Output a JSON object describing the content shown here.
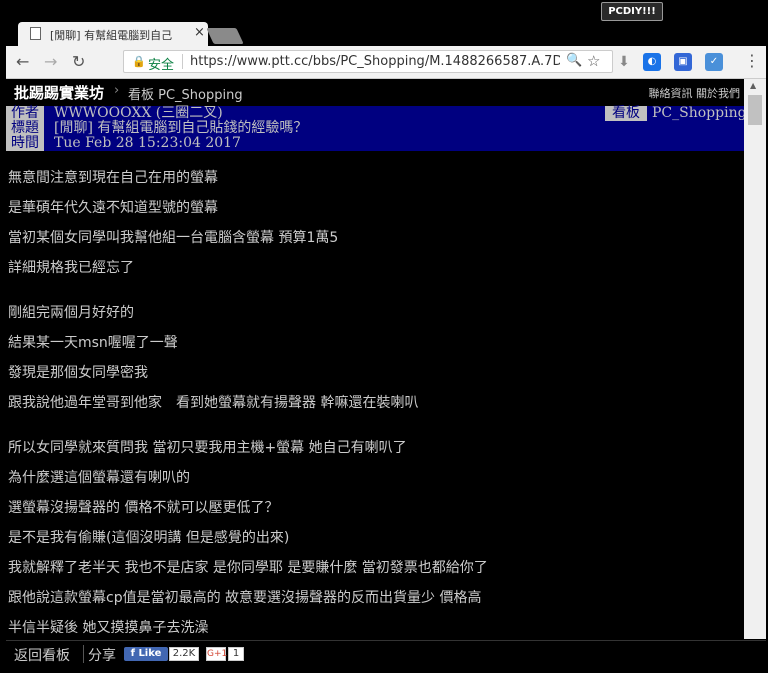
{
  "watermark": "PCDIY!!!",
  "tab": {
    "title": "[閒聊] 有幫組電腦到自己",
    "close": "×"
  },
  "toolbar": {
    "back": "←",
    "forward": "→",
    "reload": "↻",
    "secure_label": "安全",
    "url": "https://www.ptt.cc/bbs/PC_Shopping/M.1488266587.A.7D3",
    "zoom": "🔍",
    "star": "☆",
    "menu": "⋮"
  },
  "header": {
    "brand": "批踢踢實業坊",
    "arrow": "›",
    "board_label": "看板 PC_Shopping",
    "links": "聯絡資訊 關於我們"
  },
  "meta": {
    "author_key": "作者",
    "author": "WWWOOOXX (三圈二叉)",
    "board_key": "看板",
    "board": "PC_Shopping",
    "title_key": "標題",
    "title": "[閒聊] 有幫組電腦到自己貼錢的經驗嗎？",
    "time_key": "時間",
    "time": "Tue Feb 28 15:23:04 2017"
  },
  "content": {
    "lines_1": [
      "無意間注意到現在自己在用的螢幕",
      "是華碩年代久遠不知道型號的螢幕",
      "當初某個女同學叫我幫他組一台電腦含螢幕 預算1萬5",
      "詳細規格我已經忘了"
    ],
    "lines_2": [
      "剛組完兩個月好好的",
      "結果某一天msn喔喔了一聲",
      "發現是那個女同學密我",
      "跟我說他過年堂哥到他家　看到她螢幕就有揚聲器 幹嘛還在裝喇叭"
    ],
    "lines_3": [
      "所以女同學就來質問我 當初只要我用主機+螢幕 她自己有喇叭了",
      "為什麼選這個螢幕還有喇叭的",
      "選螢幕沒揚聲器的 價格不就可以壓更低了？",
      "是不是我有偷賺(這個沒明講 但是感覺的出來)",
      "我就解釋了老半天 我也不是店家 是你同學耶 是要賺什麼 當初發票也都給你了",
      "跟他說這款螢幕cp值是當初最高的 故意要選沒揚聲器的反而出貨量少 價格高",
      "半信半疑後 她又摸摸鼻子去洗澡"
    ]
  },
  "bottom": {
    "back_to_board": "返回看板",
    "share": "分享",
    "fb_like": "Like",
    "fb_count": "2.2K",
    "gplus": "G+1",
    "gplus_count": "1"
  }
}
